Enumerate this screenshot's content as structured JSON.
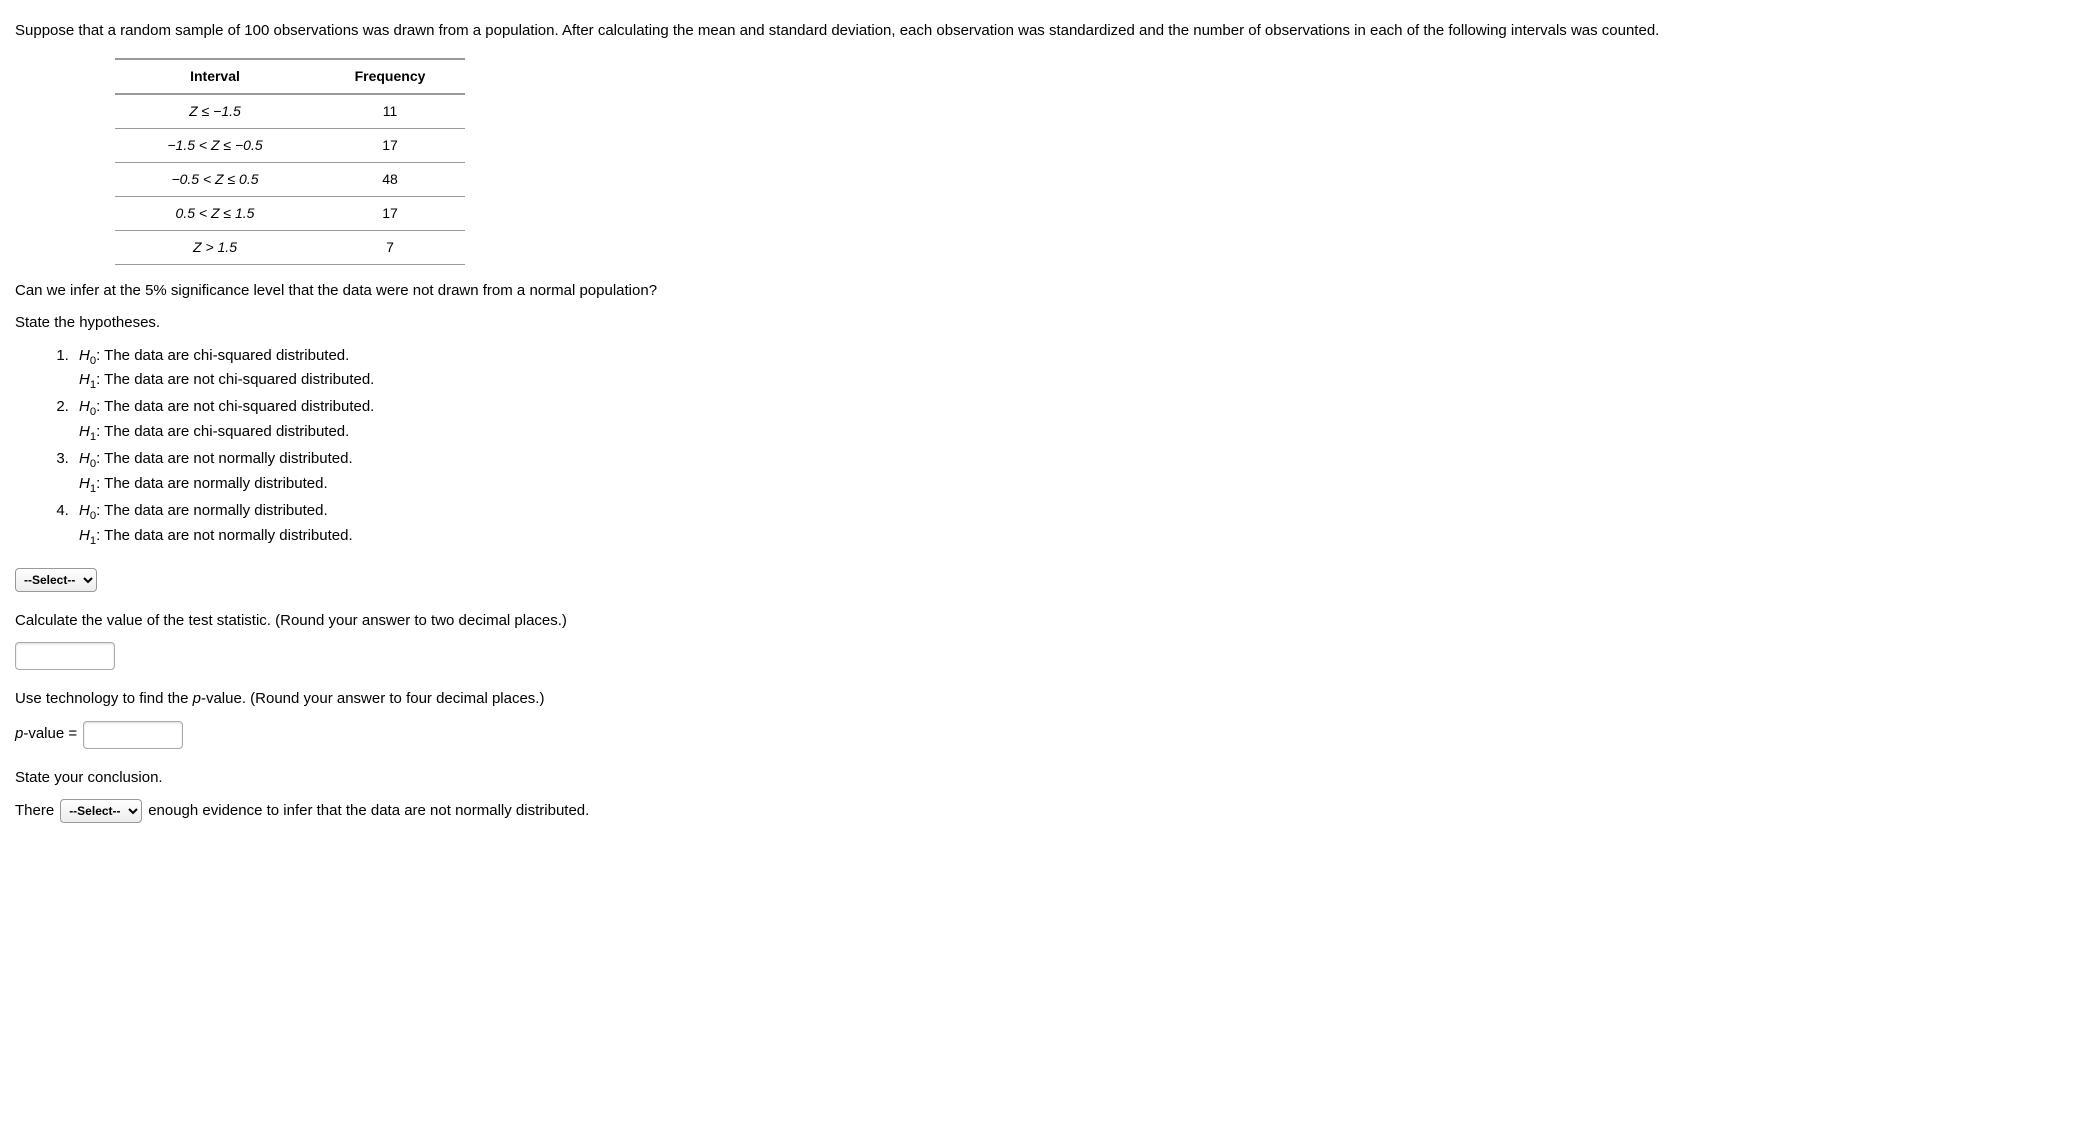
{
  "intro_text": "Suppose that a random sample of 100 observations was drawn from a population. After calculating the mean and standard deviation, each observation was standardized and the number of observations in each of the following intervals was counted.",
  "table": {
    "header_interval": "Interval",
    "header_frequency": "Frequency",
    "rows": [
      {
        "interval": "Z ≤ −1.5",
        "frequency": "11"
      },
      {
        "interval": "−1.5 < Z ≤ −0.5",
        "frequency": "17"
      },
      {
        "interval": "−0.5 < Z ≤ 0.5",
        "frequency": "48"
      },
      {
        "interval": "0.5 < Z ≤ 1.5",
        "frequency": "17"
      },
      {
        "interval": "Z > 1.5",
        "frequency": "7"
      }
    ]
  },
  "question_main": "Can we infer at the 5% significance level that the data were not drawn from a normal population?",
  "state_hypotheses": "State the hypotheses.",
  "hypotheses": [
    {
      "h0_label": "H",
      "h0_sub": "0",
      "h0_text": ": The data are chi-squared distributed.",
      "h1_label": "H",
      "h1_sub": "1",
      "h1_text": ": The data are not chi-squared distributed."
    },
    {
      "h0_label": "H",
      "h0_sub": "0",
      "h0_text": ": The data are not chi-squared distributed.",
      "h1_label": "H",
      "h1_sub": "1",
      "h1_text": ": The data are chi-squared distributed."
    },
    {
      "h0_label": "H",
      "h0_sub": "0",
      "h0_text": ": The data are not normally distributed.",
      "h1_label": "H",
      "h1_sub": "1",
      "h1_text": ": The data are normally distributed."
    },
    {
      "h0_label": "H",
      "h0_sub": "0",
      "h0_text": ": The data are normally distributed.",
      "h1_label": "H",
      "h1_sub": "1",
      "h1_text": ": The data are not normally distributed."
    }
  ],
  "select_placeholder": "--Select--",
  "calc_test_stat": "Calculate the value of the test statistic. (Round your answer to two decimal places.)",
  "find_p_value": "Use technology to find the ",
  "find_p_value_p": "p",
  "find_p_value_rest": "-value. (Round your answer to four decimal places.)",
  "p_value_label_p": "p",
  "p_value_label_rest": "-value =",
  "state_conclusion": "State your conclusion.",
  "conclusion_prefix": "There",
  "conclusion_suffix": "enough evidence to infer that the data are not normally distributed."
}
